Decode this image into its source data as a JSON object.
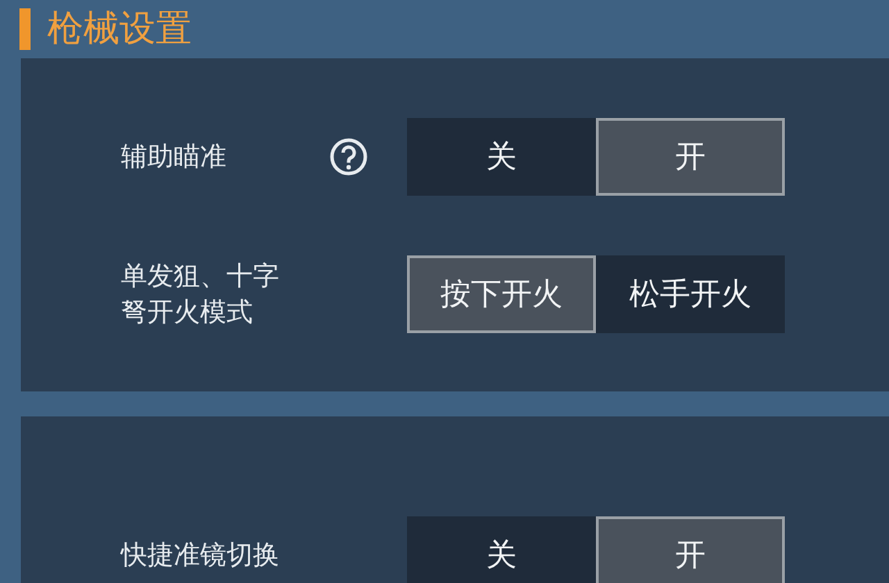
{
  "section_title": "枪械设置",
  "panels": [
    {
      "rows": [
        {
          "label": "辅助瞄准",
          "help": true,
          "options": [
            {
              "label": "关",
              "selected": false
            },
            {
              "label": "开",
              "selected": true
            }
          ]
        },
        {
          "label": "单发狙、十字弩开火模式",
          "help": false,
          "options": [
            {
              "label": "按下开火",
              "selected": true
            },
            {
              "label": "松手开火",
              "selected": false
            }
          ]
        }
      ]
    },
    {
      "rows": [
        {
          "label": "快捷准镜切换",
          "help": false,
          "options": [
            {
              "label": "关",
              "selected": false
            },
            {
              "label": "开",
              "selected": true
            }
          ]
        }
      ]
    }
  ]
}
